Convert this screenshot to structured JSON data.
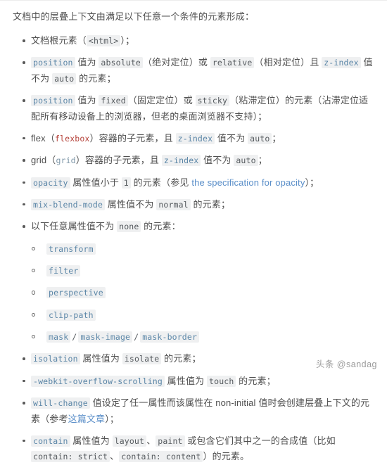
{
  "document": {
    "intro": "文档中的层叠上下文由满足以下任意一个条件的元素形成：",
    "items": [
      {
        "id": "root-element",
        "parts": [
          {
            "t": "text",
            "v": "文档根元素（"
          },
          {
            "t": "code",
            "style": "val",
            "v": "<html>"
          },
          {
            "t": "text",
            "v": "）；"
          }
        ]
      },
      {
        "id": "position-absolute-relative",
        "parts": [
          {
            "t": "code",
            "style": "prop",
            "v": "position"
          },
          {
            "t": "text",
            "v": " 值为 "
          },
          {
            "t": "code",
            "style": "val",
            "v": "absolute"
          },
          {
            "t": "text",
            "v": "（绝对定位）或 "
          },
          {
            "t": "code",
            "style": "val",
            "v": "relative"
          },
          {
            "t": "text",
            "v": "（相对定位）且 "
          },
          {
            "t": "code",
            "style": "prop",
            "v": "z-index"
          },
          {
            "t": "text",
            "v": " 值不为 "
          },
          {
            "t": "code",
            "style": "val",
            "v": "auto"
          },
          {
            "t": "text",
            "v": " 的元素；"
          }
        ]
      },
      {
        "id": "position-fixed-sticky",
        "parts": [
          {
            "t": "code",
            "style": "prop",
            "v": "position"
          },
          {
            "t": "text",
            "v": " 值为 "
          },
          {
            "t": "code",
            "style": "val",
            "v": "fixed"
          },
          {
            "t": "text",
            "v": "（固定定位）或 "
          },
          {
            "t": "code",
            "style": "val",
            "v": "sticky"
          },
          {
            "t": "text",
            "v": "（粘滞定位）的元素（沾滞定位适配所有移动设备上的浏览器，但老的桌面浏览器不支持）；"
          }
        ]
      },
      {
        "id": "flex-child",
        "parts": [
          {
            "t": "text",
            "v": "flex（"
          },
          {
            "t": "code",
            "style": "bare red",
            "v": "flexbox"
          },
          {
            "t": "text",
            "v": "）容器的子元素，且 "
          },
          {
            "t": "code",
            "style": "prop",
            "v": "z-index"
          },
          {
            "t": "text",
            "v": " 值不为 "
          },
          {
            "t": "code",
            "style": "val",
            "v": "auto"
          },
          {
            "t": "text",
            "v": "；"
          }
        ]
      },
      {
        "id": "grid-child",
        "parts": [
          {
            "t": "text",
            "v": "grid（"
          },
          {
            "t": "code",
            "style": "bare prop",
            "v": "grid"
          },
          {
            "t": "text",
            "v": "）容器的子元素，且 "
          },
          {
            "t": "code",
            "style": "prop",
            "v": "z-index"
          },
          {
            "t": "text",
            "v": " 值不为 "
          },
          {
            "t": "code",
            "style": "val",
            "v": "auto"
          },
          {
            "t": "text",
            "v": "；"
          }
        ]
      },
      {
        "id": "opacity",
        "parts": [
          {
            "t": "code",
            "style": "prop",
            "v": "opacity"
          },
          {
            "t": "text",
            "v": " 属性值小于 "
          },
          {
            "t": "code",
            "style": "val",
            "v": "1"
          },
          {
            "t": "text",
            "v": " 的元素（参见 "
          },
          {
            "t": "link",
            "v": "the specification for opacity"
          },
          {
            "t": "text",
            "v": "）；"
          }
        ]
      },
      {
        "id": "mix-blend-mode",
        "parts": [
          {
            "t": "code",
            "style": "prop",
            "v": "mix-blend-mode"
          },
          {
            "t": "text",
            "v": " 属性值不为 "
          },
          {
            "t": "code",
            "style": "val",
            "v": "normal"
          },
          {
            "t": "text",
            "v": " 的元素；"
          }
        ]
      },
      {
        "id": "any-property-not-none",
        "parts": [
          {
            "t": "text",
            "v": "以下任意属性值不为 "
          },
          {
            "t": "code",
            "style": "val",
            "v": "none"
          },
          {
            "t": "text",
            "v": " 的元素："
          }
        ],
        "sub_items": [
          {
            "id": "transform",
            "parts": [
              {
                "t": "code",
                "style": "prop",
                "v": "transform"
              }
            ]
          },
          {
            "id": "filter",
            "parts": [
              {
                "t": "code",
                "style": "prop",
                "v": "filter"
              }
            ]
          },
          {
            "id": "perspective",
            "parts": [
              {
                "t": "code",
                "style": "prop",
                "v": "perspective"
              }
            ]
          },
          {
            "id": "clip-path",
            "parts": [
              {
                "t": "code",
                "style": "prop",
                "v": "clip-path"
              }
            ]
          },
          {
            "id": "mask-group",
            "parts": [
              {
                "t": "code",
                "style": "prop",
                "v": "mask"
              },
              {
                "t": "sep",
                "v": "/"
              },
              {
                "t": "code",
                "style": "prop",
                "v": "mask-image"
              },
              {
                "t": "sep",
                "v": "/"
              },
              {
                "t": "code",
                "style": "prop",
                "v": "mask-border"
              }
            ]
          }
        ]
      },
      {
        "id": "isolation",
        "parts": [
          {
            "t": "code",
            "style": "prop",
            "v": "isolation"
          },
          {
            "t": "text",
            "v": " 属性值为 "
          },
          {
            "t": "code",
            "style": "val",
            "v": "isolate"
          },
          {
            "t": "text",
            "v": " 的元素；"
          }
        ]
      },
      {
        "id": "webkit-overflow-scrolling",
        "parts": [
          {
            "t": "code",
            "style": "prop",
            "v": "-webkit-overflow-scrolling"
          },
          {
            "t": "text",
            "v": " 属性值为 "
          },
          {
            "t": "code",
            "style": "val",
            "v": "touch"
          },
          {
            "t": "text",
            "v": " 的元素；"
          }
        ]
      },
      {
        "id": "will-change",
        "parts": [
          {
            "t": "code",
            "style": "prop",
            "v": "will-change"
          },
          {
            "t": "text",
            "v": " 值设定了任一属性而该属性在 non-initial 值时会创建层叠上下文的元素（参考"
          },
          {
            "t": "link",
            "v": "这篇文章"
          },
          {
            "t": "text",
            "v": "）；"
          }
        ]
      },
      {
        "id": "contain",
        "parts": [
          {
            "t": "code",
            "style": "prop",
            "v": "contain"
          },
          {
            "t": "text",
            "v": " 属性值为 "
          },
          {
            "t": "code",
            "style": "val",
            "v": "layout"
          },
          {
            "t": "text",
            "v": "、"
          },
          {
            "t": "code",
            "style": "val",
            "v": "paint"
          },
          {
            "t": "text",
            "v": " 或包含它们其中之一的合成值（比如 "
          },
          {
            "t": "code",
            "style": "val",
            "v": "contain: strict"
          },
          {
            "t": "text",
            "v": "、"
          },
          {
            "t": "code",
            "style": "val",
            "v": "contain: content"
          },
          {
            "t": "text",
            "v": "）的元素。"
          }
        ]
      }
    ]
  },
  "watermark": {
    "text": "头条 @sandag"
  }
}
